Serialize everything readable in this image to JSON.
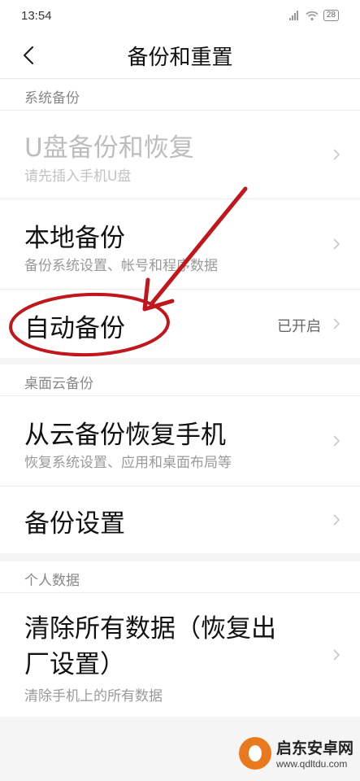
{
  "status_bar": {
    "time": "13:54",
    "battery": "28"
  },
  "header": {
    "title": "备份和重置"
  },
  "sections": [
    {
      "header": "系统备份",
      "rows": [
        {
          "title": "U盘备份和恢复",
          "subtitle": "请先插入手机U盘",
          "disabled": true
        },
        {
          "title": "本地备份",
          "subtitle": "备份系统设置、帐号和程序数据"
        },
        {
          "title": "自动备份",
          "value": "已开启"
        }
      ]
    },
    {
      "header": "桌面云备份",
      "rows": [
        {
          "title": "从云备份恢复手机",
          "subtitle": "恢复系统设置、应用和桌面布局等"
        },
        {
          "title": "备份设置"
        }
      ]
    },
    {
      "header": "个人数据",
      "rows": [
        {
          "title_line1": "清除所有数据（恢复出",
          "title_line2": "厂设置）",
          "subtitle": "清除手机上的所有数据"
        }
      ]
    }
  ],
  "annotation": {
    "color": "#c0161c"
  },
  "watermark": {
    "main": "启东安卓网",
    "sub": "www.qdltdu.com",
    "logo_color": "#e8791c"
  }
}
